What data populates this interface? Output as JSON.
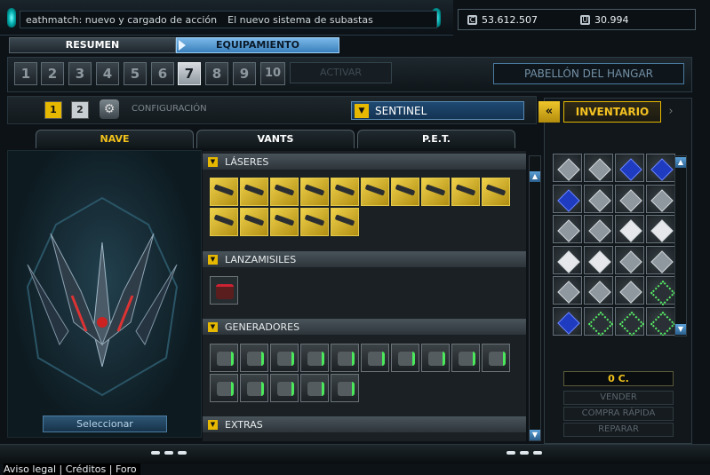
{
  "ticker": {
    "messages": [
      "eathmatch: nuevo y cargado de acción",
      "El nuevo sistema de subastas"
    ]
  },
  "currency": {
    "credits": "53.612.507",
    "uridium": "30.994"
  },
  "main_tabs": [
    "RESUMEN",
    "EQUIPAMIENTO"
  ],
  "config_numbers": [
    "1",
    "2",
    "3",
    "4",
    "5",
    "6",
    "7",
    "8",
    "9",
    "10"
  ],
  "active_config": "7",
  "activate_label": "ACTIVAR",
  "hangar_label": "PABELLÓN DEL HANGAR",
  "sub_config": {
    "slot1": "1",
    "slot2": "2",
    "label": "CONFIGURACIÓN"
  },
  "ship_name": "SENTINEL",
  "sub_tabs": [
    "NAVE",
    "VANTS",
    "P.E.T."
  ],
  "select_label": "Seleccionar",
  "sections": {
    "lasers": {
      "title": "LÁSERES",
      "count": 15
    },
    "launchers": {
      "title": "LANZAMISILES",
      "count": 1
    },
    "generators": {
      "title": "GENERADORES",
      "count": 15
    },
    "extras": {
      "title": "EXTRAS"
    }
  },
  "inventory": {
    "title": "INVENTARIO",
    "back_icon": "double-chevron-left-icon",
    "price": "0 C.",
    "sell": "VENDER",
    "quick_buy": "COMPRA RÁPIDA",
    "repair": "REPARAR",
    "items": [
      "gray",
      "gray",
      "blue",
      "blue",
      "blue",
      "gray",
      "gray",
      "gray",
      "gray",
      "gray",
      "white",
      "white",
      "white",
      "white",
      "gray",
      "gray",
      "gray",
      "gray",
      "gray",
      "green",
      "blue",
      "green",
      "green",
      "green"
    ]
  },
  "footer": {
    "links": [
      "Aviso legal",
      "Créditos",
      "Foro"
    ]
  },
  "colors": {
    "accent": "#e6b800",
    "blue_tab": "#3a80bb"
  }
}
